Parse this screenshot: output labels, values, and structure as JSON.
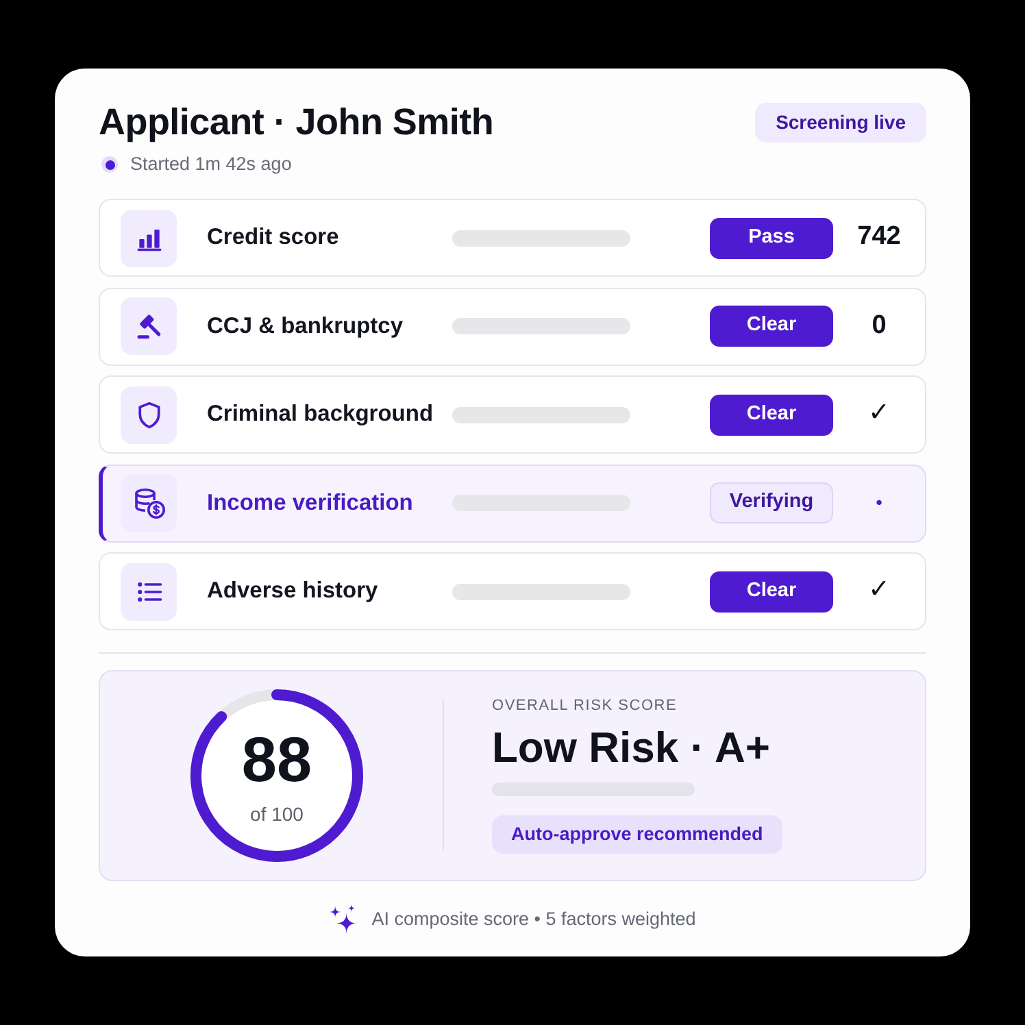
{
  "header": {
    "title": "Applicant · John Smith",
    "badge": "Screening live",
    "subtitle": "Started 1m 42s ago"
  },
  "checks": [
    {
      "label": "Credit score",
      "status": "Pass",
      "result": "742",
      "in_progress": false
    },
    {
      "label": "CCJ & bankruptcy",
      "status": "Clear",
      "result": "0",
      "in_progress": false
    },
    {
      "label": "Criminal background",
      "status": "Clear",
      "result": "✓",
      "in_progress": false
    },
    {
      "label": "Income verification",
      "status": "Verifying",
      "result": "•",
      "in_progress": true
    },
    {
      "label": "Adverse history",
      "status": "Clear",
      "result": "✓",
      "in_progress": false
    }
  ],
  "score": {
    "value": "88",
    "scale": "of 100",
    "level": 0.88,
    "caption": "OVERALL RISK SCORE",
    "rating": "Low Risk · A+",
    "recommendation": "Auto-approve recommended"
  },
  "footer": "AI composite score • 5 factors weighted"
}
